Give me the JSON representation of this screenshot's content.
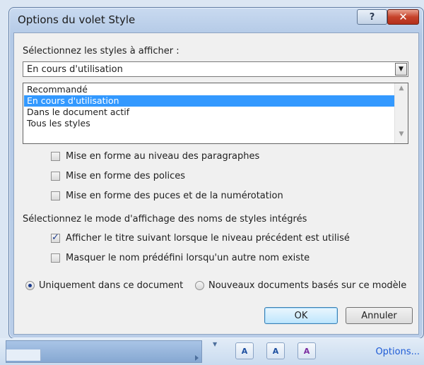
{
  "window": {
    "title": "Options du volet Style",
    "help_label": "?",
    "close_label": "✕"
  },
  "select_styles": {
    "label": "Sélectionnez les styles à afficher :",
    "current_value": "En cours d'utilisation",
    "options": [
      "Recommandé",
      "En cours d'utilisation",
      "Dans le document actif",
      "Tous les styles"
    ],
    "selected_index": 1
  },
  "format_checkboxes": [
    {
      "label": "Mise en forme au niveau des paragraphes",
      "checked": false
    },
    {
      "label": "Mise en forme des polices",
      "checked": false
    },
    {
      "label": "Mise en forme des puces et de la numérotation",
      "checked": false
    }
  ],
  "builtin_names": {
    "label": "Sélectionnez le mode d'affichage des noms de styles intégrés",
    "checkboxes": [
      {
        "label": "Afficher le titre suivant lorsque le niveau précédent est utilisé",
        "checked": true
      },
      {
        "label": "Masquer le nom prédéfini lorsqu'un autre nom existe",
        "checked": false
      }
    ]
  },
  "scope": {
    "options": [
      {
        "label": "Uniquement dans ce document",
        "checked": true
      },
      {
        "label": "Nouveaux documents basés sur ce modèle",
        "checked": false
      }
    ]
  },
  "buttons": {
    "ok": "OK",
    "cancel": "Annuler"
  },
  "pane": {
    "options_link": "Options...",
    "tools": [
      {
        "icon": "new-style-icon",
        "glyph": "A"
      },
      {
        "icon": "style-inspector-icon",
        "glyph": "A"
      },
      {
        "icon": "manage-styles-icon",
        "glyph": "A"
      }
    ]
  },
  "colors": {
    "selection": "#3399ff",
    "link": "#1e5bd6",
    "close": "#c6432b"
  }
}
